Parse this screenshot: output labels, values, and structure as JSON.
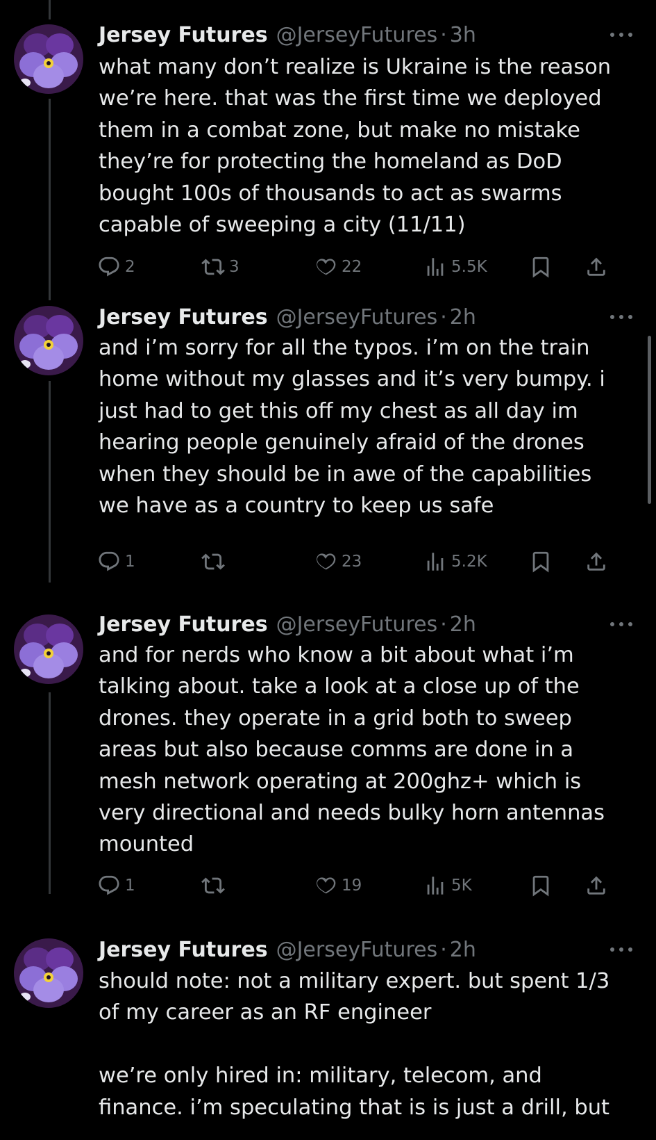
{
  "author": {
    "name": "Jersey Futures",
    "handle": "@JerseyFutures"
  },
  "colors": {
    "background": "#000000",
    "text": "#e7e9ea",
    "muted": "#71767b",
    "thread_line": "#333639"
  },
  "tweets": [
    {
      "name": "Jersey Futures",
      "handle": "@JerseyFutures",
      "dot": "·",
      "time": "3h",
      "text": "what many don’t realize is Ukraine is the reason\nwe’re here. that was the first time we deployed\nthem in a combat zone, but make no mistake\nthey’re for protecting the homeland as DoD\nbought 100s of thousands to act as swarms\ncapable of sweeping a city (11/11)",
      "replies": "2",
      "reposts": "3",
      "likes": "22",
      "views": "5.5K"
    },
    {
      "name": "Jersey Futures",
      "handle": "@JerseyFutures",
      "dot": "·",
      "time": "2h",
      "text": "and i’m sorry for all the typos. i’m on the train\nhome without my glasses and it’s very bumpy. i\njust had to get this off my chest as all day im\nhearing people genuinely afraid of the drones\nwhen they should be in awe of the capabilities\nwe have as a country to keep us safe",
      "replies": "1",
      "reposts": "",
      "likes": "23",
      "views": "5.2K"
    },
    {
      "name": "Jersey Futures",
      "handle": "@JerseyFutures",
      "dot": "·",
      "time": "2h",
      "text": "and for nerds who know a bit about what i’m\ntalking about. take a look at a close up of the\ndrones. they operate in a grid both to sweep\nareas but also because comms are done in a\nmesh network operating at 200ghz+ which is\nvery directional and needs bulky horn antennas\nmounted",
      "replies": "1",
      "reposts": "",
      "likes": "19",
      "views": "5K"
    },
    {
      "name": "Jersey Futures",
      "handle": "@JerseyFutures",
      "dot": "·",
      "time": "2h",
      "text": "should note: not a military expert. but spent 1/3\nof my career as an RF engineer\n\nwe’re only hired in: military, telecom, and\nfinance. i’m speculating that is is just a drill, but"
    }
  ]
}
